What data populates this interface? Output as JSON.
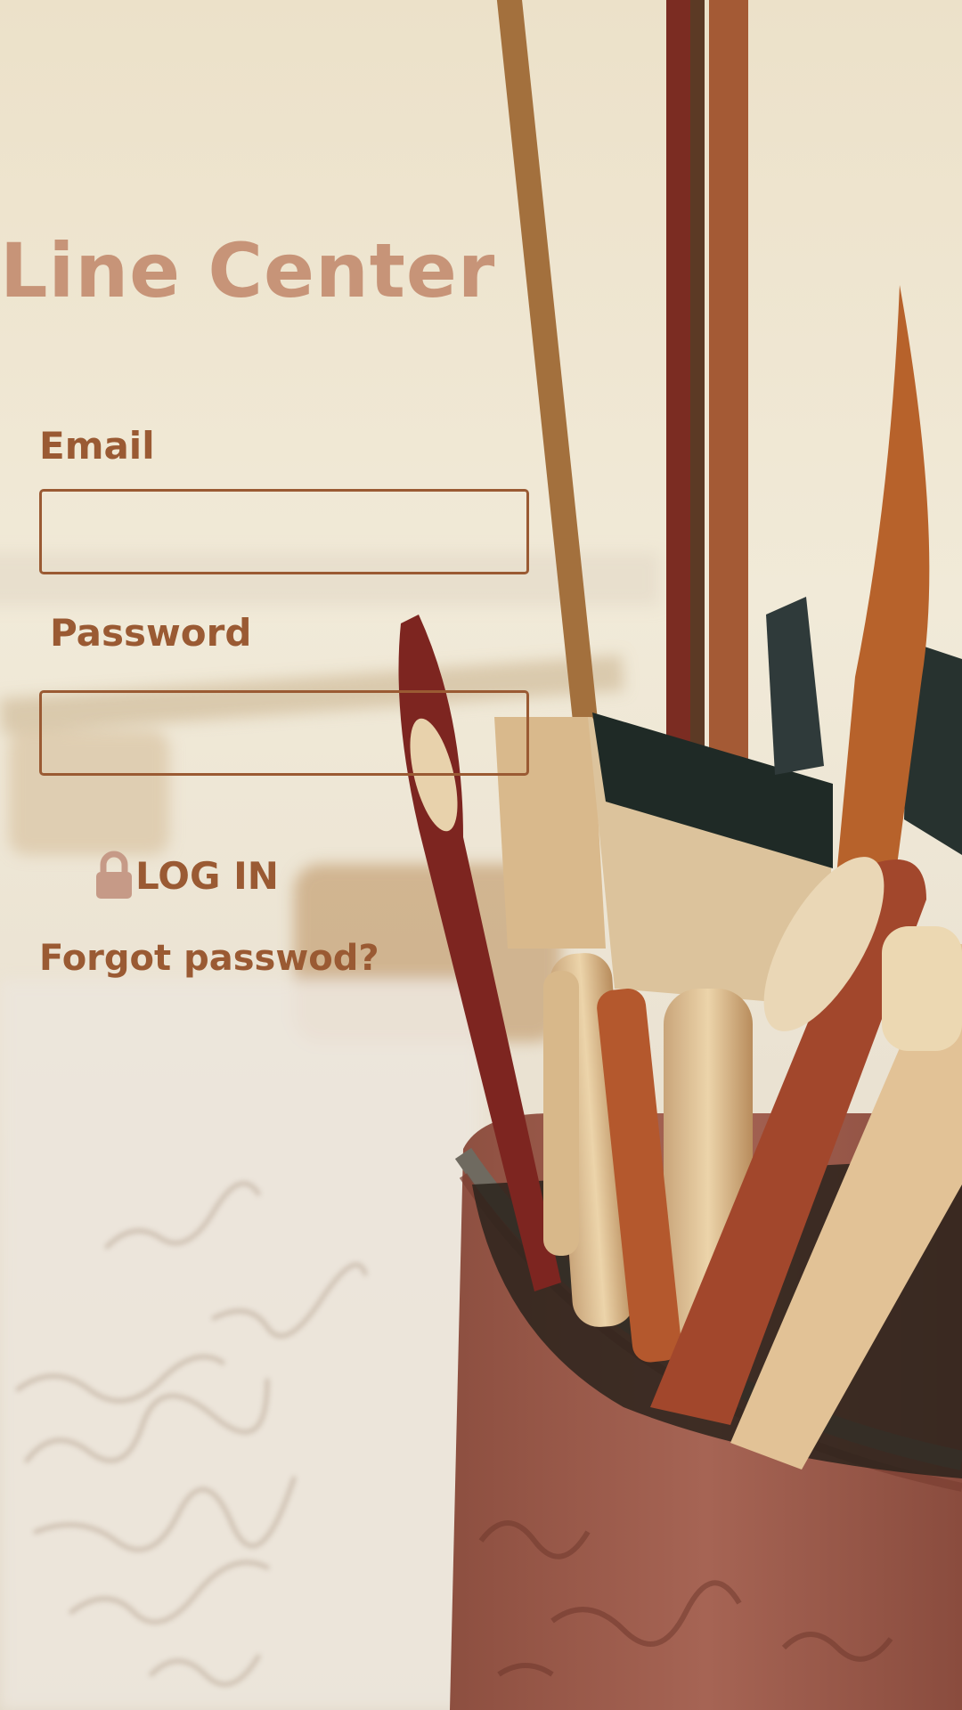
{
  "app": {
    "title": "Line Center"
  },
  "form": {
    "email_label": "Email",
    "email_value": "",
    "password_label": "Password",
    "password_value": "",
    "login_label": "LOG IN",
    "forgot_label": "Forgot passwod?"
  },
  "icons": {
    "login": "lock-icon"
  },
  "colors": {
    "title": "#c79478",
    "label": "#9a5a33",
    "input_border": "#9a5a33",
    "lock": "#c69a87"
  }
}
